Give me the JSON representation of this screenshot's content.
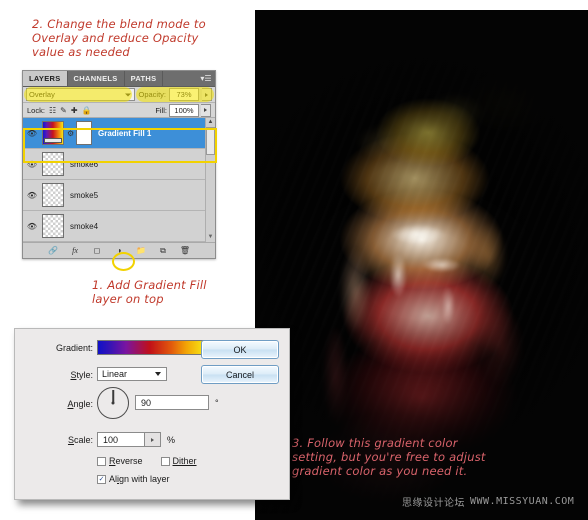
{
  "notes": {
    "step2": "2. Change the blend mode to\nOverlay and reduce Opacity\nvalue as needed",
    "step1": "1. Add Gradient Fill\nlayer on top",
    "step3": "3. Follow this gradient color\nsetting, but you're free to adjust\ngradient color as you need it."
  },
  "layers_panel": {
    "tabs": [
      {
        "label": "LAYERS",
        "active": true
      },
      {
        "label": "CHANNELS",
        "active": false
      },
      {
        "label": "PATHS",
        "active": false
      }
    ],
    "menu_icon": "panel-menu-icon",
    "blend_mode": "Overlay",
    "opacity_label": "Opacity:",
    "opacity_value": "73%",
    "lock_label": "Lock:",
    "lock_icons": [
      "lock-transparency-icon",
      "lock-image-icon",
      "lock-position-icon",
      "lock-all-icon"
    ],
    "fill_label": "Fill:",
    "fill_value": "100%",
    "layers": [
      {
        "name": "Gradient Fill 1",
        "selected": true,
        "thumb": "gradient",
        "has_mask": true,
        "visible": true
      },
      {
        "name": "smoke6",
        "selected": false,
        "thumb": "checker",
        "has_mask": false,
        "visible": true
      },
      {
        "name": "smoke5",
        "selected": false,
        "thumb": "checker",
        "has_mask": false,
        "visible": true
      },
      {
        "name": "smoke4",
        "selected": false,
        "thumb": "checker",
        "has_mask": false,
        "visible": true
      }
    ],
    "footer_buttons": [
      "link-layers-icon",
      "layer-style-fx-icon",
      "add-layer-mask-icon",
      "new-fill-adjustment-layer-icon",
      "new-group-icon",
      "new-layer-icon",
      "delete-layer-icon"
    ]
  },
  "gradient_dialog": {
    "fields": {
      "gradient_label": "Gradient:",
      "style_label": "Style:",
      "style_value": "Linear",
      "angle_label": "Angle:",
      "angle_value": "90",
      "angle_unit": "°",
      "scale_label": "Scale:",
      "scale_value": "100",
      "scale_unit": "%"
    },
    "checkboxes": [
      {
        "label": "Reverse",
        "checked": false
      },
      {
        "label": "Dither",
        "checked": false
      },
      {
        "label": "Align with layer",
        "checked": true
      }
    ],
    "buttons": {
      "ok": "OK",
      "cancel": "Cancel"
    },
    "gradient_colors": [
      "#1010c8",
      "#7a14a0",
      "#c11018",
      "#e25a0c",
      "#f8ec16"
    ]
  },
  "watermark": {
    "cn": "思缘设计论坛",
    "url": "WWW.MISSYUAN.COM"
  },
  "colors": {
    "note_red": "#c0392b",
    "note_red_on_black": "#d9636b",
    "highlight_yellow": "#f2d200",
    "selection_blue": "#3d8fd8"
  }
}
